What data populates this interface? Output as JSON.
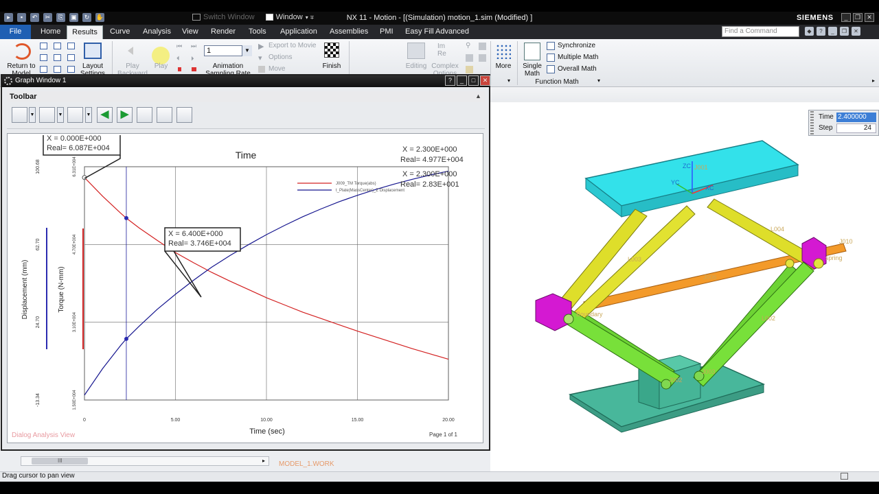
{
  "app": {
    "window_title": "NX 11 - Motion - [(Simulation) motion_1.sim (Modified) ]",
    "brand": "SIEMENS",
    "switch_window": "Switch Window",
    "window_menu": "Window",
    "search_placeholder": "Find a Command"
  },
  "menu": {
    "file": "File",
    "tabs": [
      "Home",
      "Results",
      "Curve",
      "Analysis",
      "View",
      "Render",
      "Tools",
      "Application",
      "Assemblies",
      "PMI",
      "Easy Fill Advanced"
    ],
    "active": "Results"
  },
  "ribbon": {
    "return_to_model": "Return to Model",
    "layout_settings": "Layout Settings",
    "play_backward": "Play Backward",
    "play": "Play",
    "step_value": "1",
    "animation_sampling_rate": "Animation Sampling Rate",
    "export_to_movie": "Export to Movie",
    "options": "Options",
    "move": "Move",
    "finish": "Finish",
    "editing": "Editing",
    "complex_options": "Complex Options",
    "more": "More",
    "single_math": "Single Math",
    "synchronize": "Synchronize",
    "multiple_math": "Multiple Math",
    "overall_math": "Overall Math",
    "function_math_group": "Function Math"
  },
  "graph_window": {
    "title": "Graph Window 1",
    "toolbar_label": "Toolbar"
  },
  "time_step": {
    "time_label": "Time",
    "time_value": "2.400000",
    "step_label": "Step",
    "step_value": "24"
  },
  "status": {
    "text": "Drag cursor to pan view",
    "model_tab": "MODEL_1.WORK",
    "scroll_marker": "III"
  },
  "model_labels": [
    "ZC",
    "J001",
    "YC",
    "XC",
    "L004",
    "J010",
    "L002",
    "L003",
    "J002",
    "J003",
    "L001",
    "Boundary",
    "spring",
    "J006"
  ],
  "chart_data": {
    "type": "line",
    "title": "Time",
    "xlabel": "Time (sec)",
    "ylabel_outer": "Displacement (mm)",
    "ylabel_inner": "Torque (N-mm)",
    "xlim": [
      0,
      20
    ],
    "x_ticks": [
      "0",
      "5.00",
      "10.00",
      "15.00",
      "20.00"
    ],
    "y_left_ticks": [
      "-13.34",
      "24.70",
      "62.70",
      "100.68"
    ],
    "y_inner_ticks": [
      "1.50E+004",
      "3.10E+004",
      "4.70E+004",
      "6.31E+004"
    ],
    "series": [
      {
        "name": "J009_TM Torque(abs)",
        "color": "#d32020",
        "x": [
          0,
          1,
          2,
          2.3,
          3,
          4,
          5,
          6,
          6.4,
          7,
          8,
          9,
          10,
          11,
          12,
          13,
          14,
          15,
          16,
          17,
          18,
          19,
          20
        ],
        "values": [
          60870,
          57000,
          53500,
          52500,
          50500,
          47900,
          45400,
          43300,
          42500,
          41300,
          39500,
          37800,
          36100,
          34600,
          33100,
          31800,
          30500,
          29200,
          28000,
          26800,
          25600,
          24500,
          23400
        ]
      },
      {
        "name": "t_Plate(MassCenter)_Z Displacement",
        "color": "#14148e",
        "x": [
          0,
          1,
          2,
          2.3,
          3,
          4,
          5,
          6,
          6.4,
          7,
          8,
          9,
          10,
          11,
          12,
          13,
          14,
          15,
          16,
          17,
          18,
          19,
          20
        ],
        "values": [
          16000,
          21500,
          26300,
          27600,
          30200,
          33700,
          36800,
          39700,
          40800,
          42400,
          44800,
          47000,
          49100,
          51000,
          52800,
          54400,
          55900,
          57200,
          58400,
          59500,
          60500,
          61400,
          62200
        ]
      }
    ],
    "annotations": [
      {
        "x": "0.000E+000",
        "real": "6.087E+004"
      },
      {
        "x": "2.300E+000",
        "real": "4.977E+004"
      },
      {
        "x": "2.300E+000",
        "real": "2.83E+001"
      },
      {
        "x": "6.400E+000",
        "real": "3.746E+004"
      }
    ],
    "footer_left": "Dialog Analysis View",
    "footer_right": "Page 1 of 1",
    "grid": true,
    "legend": "top-right"
  }
}
